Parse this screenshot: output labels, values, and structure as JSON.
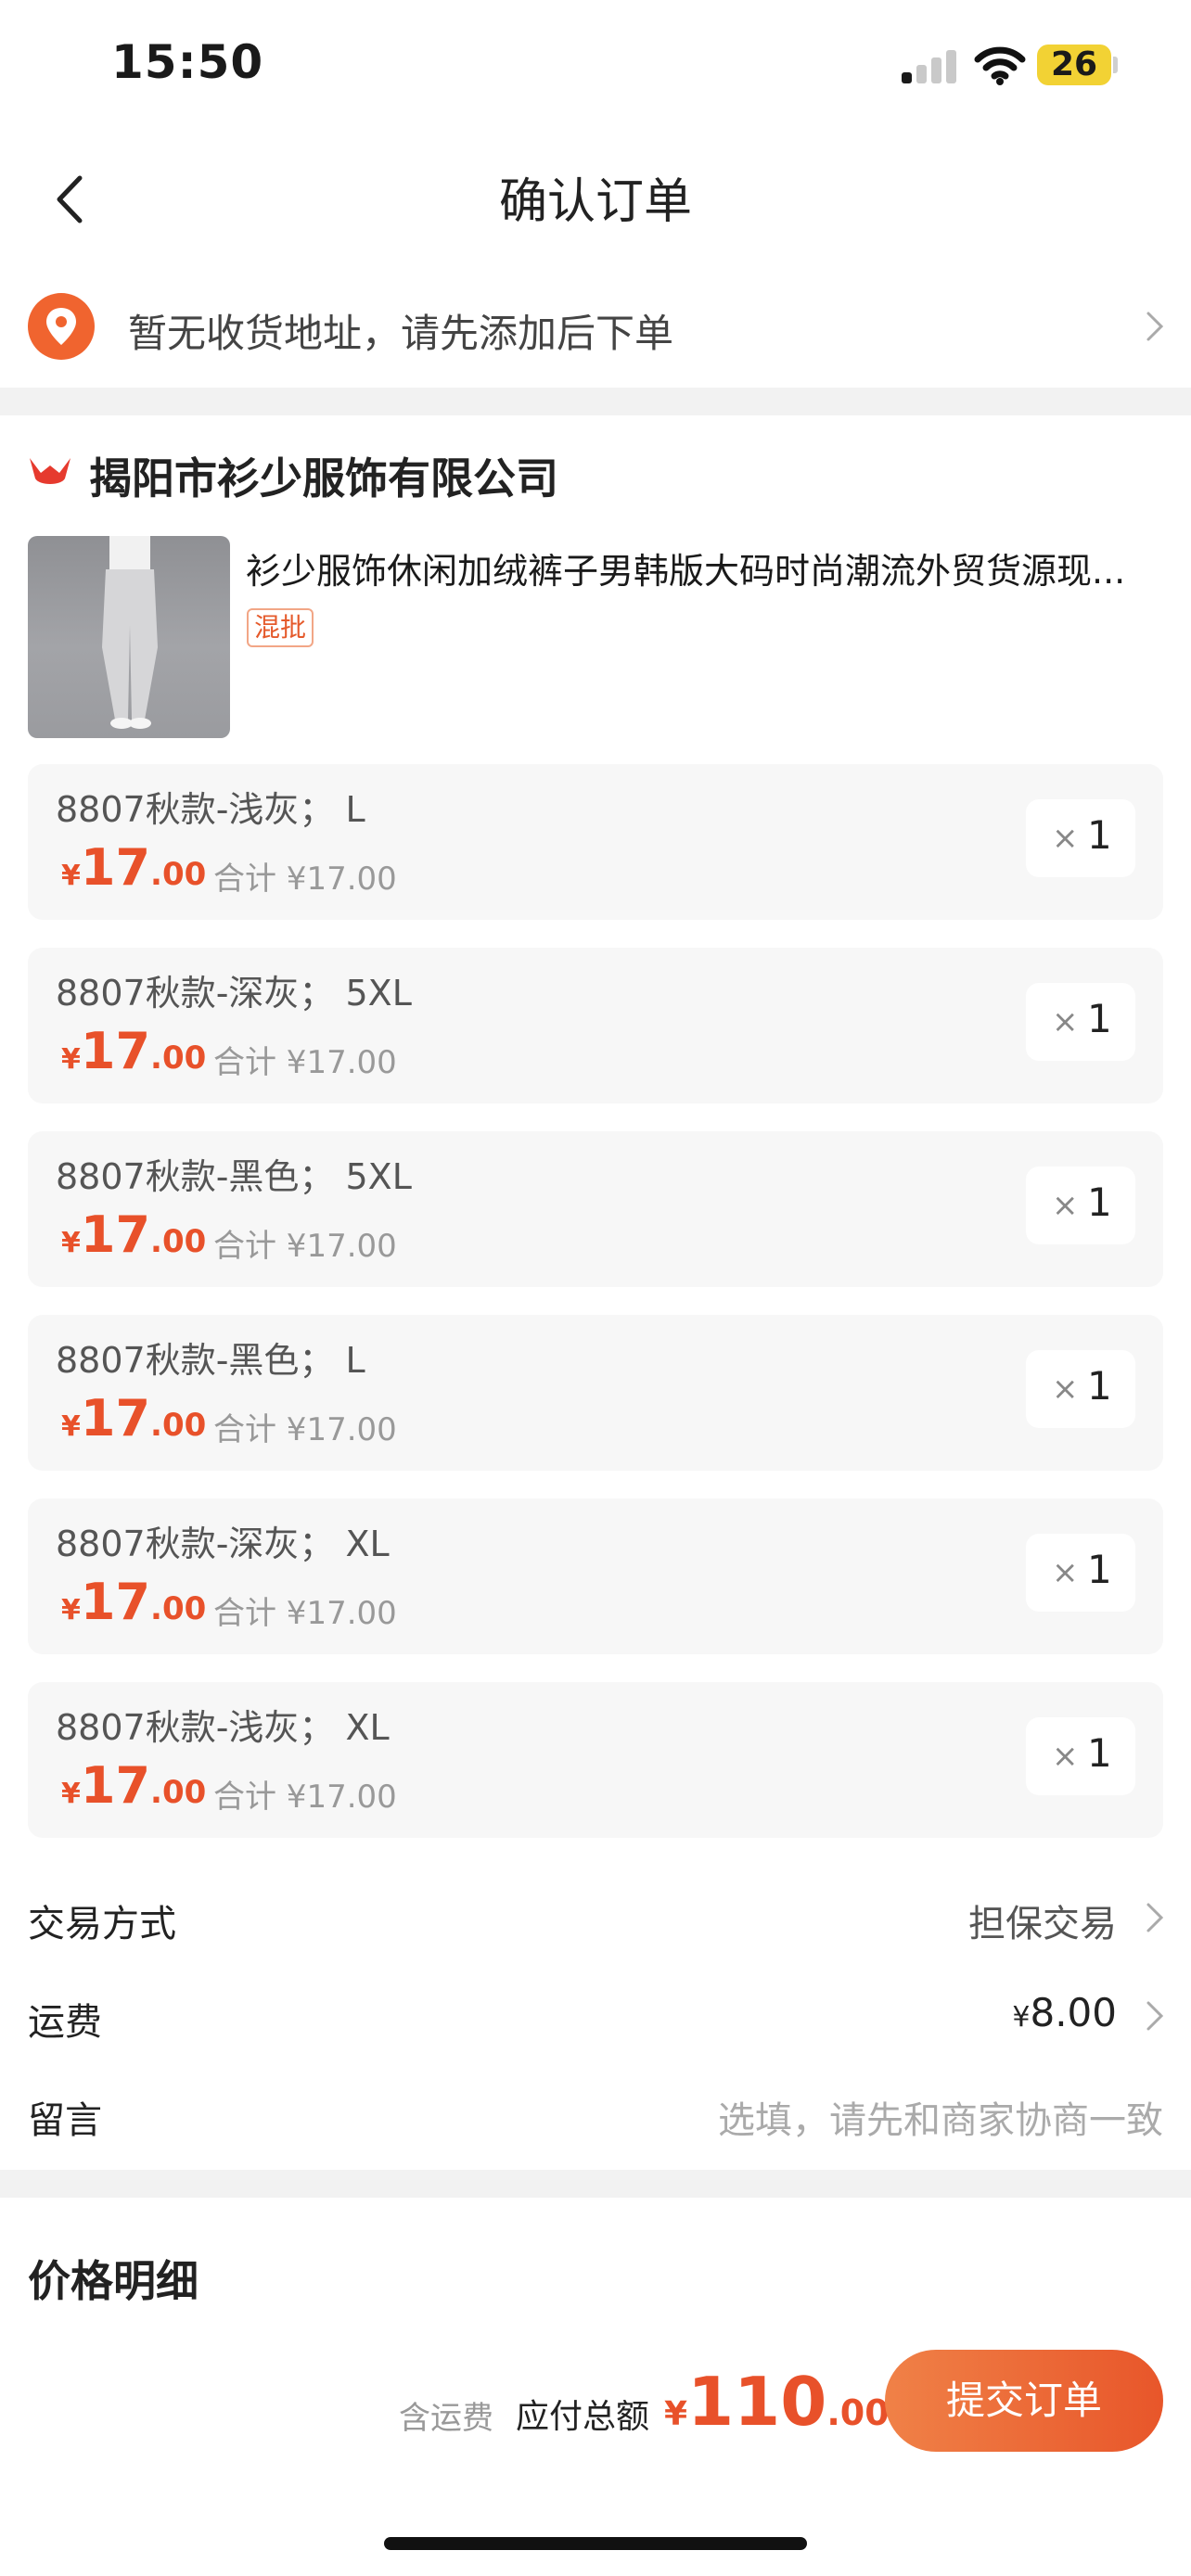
{
  "status_bar": {
    "time": "15:50",
    "battery": "26"
  },
  "nav": {
    "title": "确认订单"
  },
  "address": {
    "text": "暂无收货地址，请先添加后下单"
  },
  "shop": {
    "name": "揭阳市衫少服饰有限公司",
    "product_title": "衫少服饰休闲加绒裤子男韩版大码时尚潮流外贸货源现...",
    "tag": "混批"
  },
  "skus": [
    {
      "name": "8807秋款-浅灰； L",
      "currency": "¥",
      "price_int": "17",
      "price_dec": ".00",
      "total": "合计 ¥17.00",
      "qty_x": "×",
      "qty": "1"
    },
    {
      "name": "8807秋款-深灰； 5XL",
      "currency": "¥",
      "price_int": "17",
      "price_dec": ".00",
      "total": "合计 ¥17.00",
      "qty_x": "×",
      "qty": "1"
    },
    {
      "name": "8807秋款-黑色； 5XL",
      "currency": "¥",
      "price_int": "17",
      "price_dec": ".00",
      "total": "合计 ¥17.00",
      "qty_x": "×",
      "qty": "1"
    },
    {
      "name": "8807秋款-黑色； L",
      "currency": "¥",
      "price_int": "17",
      "price_dec": ".00",
      "total": "合计 ¥17.00",
      "qty_x": "×",
      "qty": "1"
    },
    {
      "name": "8807秋款-深灰； XL",
      "currency": "¥",
      "price_int": "17",
      "price_dec": ".00",
      "total": "合计 ¥17.00",
      "qty_x": "×",
      "qty": "1"
    },
    {
      "name": "8807秋款-浅灰； XL",
      "currency": "¥",
      "price_int": "17",
      "price_dec": ".00",
      "total": "合计 ¥17.00",
      "qty_x": "×",
      "qty": "1"
    }
  ],
  "trade": {
    "label": "交易方式",
    "value": "担保交易"
  },
  "shipping": {
    "label": "运费",
    "currency": "¥",
    "value": "8.00"
  },
  "message": {
    "label": "留言",
    "placeholder": "选填，请先和商家协商一致"
  },
  "price_detail": {
    "title": "价格明细"
  },
  "bottom_bar": {
    "includes_shipping": "含运费",
    "due_label": "应付总额",
    "currency": "¥",
    "total_int": "110",
    "total_dec": ".00",
    "submit_label": "提交订单"
  },
  "colors": {
    "accent": "#e8512a",
    "band": "#f2f2f2",
    "card": "#f7f7f7"
  },
  "icons": [
    "back-chevron-icon",
    "location-pin-icon",
    "chevron-right-icon",
    "shop-logo-icon",
    "cellular-signal-icon",
    "wifi-icon",
    "battery-icon"
  ]
}
